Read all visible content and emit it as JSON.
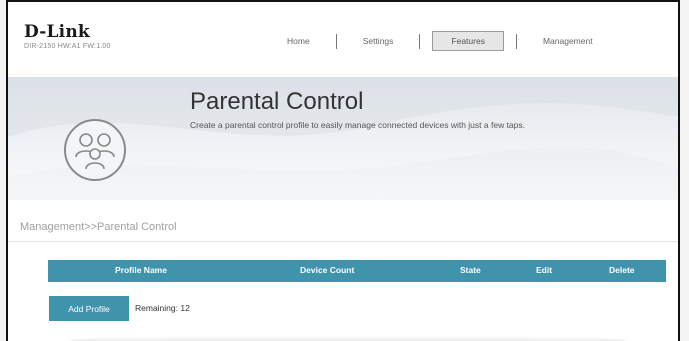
{
  "brand": {
    "name": "D-Link",
    "model": "DIR-2150 HW:A1 FW:1.00"
  },
  "nav": {
    "items": [
      "Home",
      "Settings",
      "Features",
      "Management"
    ],
    "active": "Features"
  },
  "page": {
    "title": "Parental Control",
    "subtitle": "Create a parental control profile to easily manage connected devices with just a few taps.",
    "breadcrumb": "Management>>Parental Control"
  },
  "table": {
    "columns": [
      "Profile Name",
      "Device Count",
      "State",
      "Edit",
      "Delete"
    ],
    "rows": []
  },
  "actions": {
    "add_profile_label": "Add Profile",
    "remaining_text": "Remaining: 12"
  },
  "colors": {
    "accent": "#3f93ab",
    "banner": "#dfe4e9"
  },
  "icons": {
    "page_icon": "family-icon"
  }
}
